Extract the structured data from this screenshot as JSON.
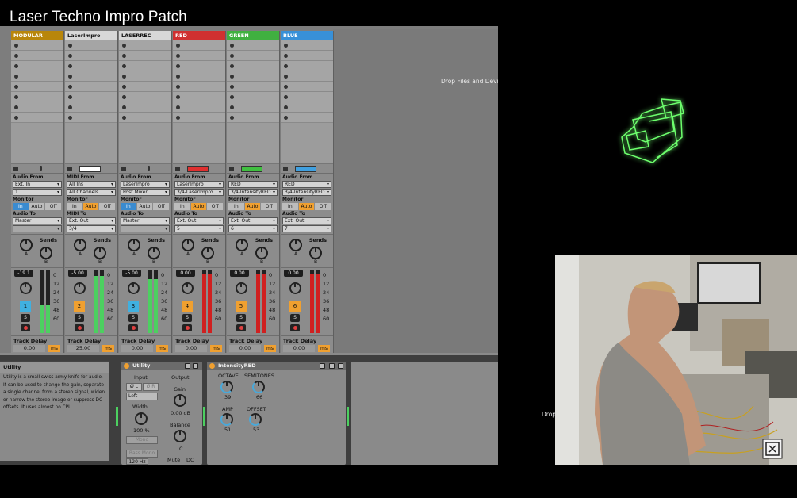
{
  "video_title": "Laser Techno Impro Patch",
  "drop_text": "Drop Files and Devices",
  "drop_text_bottom": "Drop",
  "tracks": [
    {
      "name": "MODULAR",
      "color": "#b8860b",
      "from_label": "Audio From",
      "from": "Ext. In",
      "chan": "1",
      "monitor": "In",
      "to_label": "Audio To",
      "to": "Master",
      "to2": "",
      "vol": "-19.1",
      "num": "1",
      "numcolor": "#40b0e0",
      "meterfill": "#4cd060",
      "meterlvl": 0.45,
      "delay": "0.00"
    },
    {
      "name": "LaserImpro",
      "color": "#d8d8d8",
      "from_label": "MIDI From",
      "from": "All Ins",
      "chan": "All Channels",
      "monitor": "Auto",
      "to_label": "MIDI To",
      "to": "Ext. Out",
      "to2": "3/4",
      "vol": "-5.00",
      "num": "2",
      "numcolor": "#f0a030",
      "meterfill": "#4cd060",
      "meterlvl": 0.9,
      "delay": "25.00"
    },
    {
      "name": "LASERREC",
      "color": "#d8d8d8",
      "from_label": "Audio From",
      "from": "LaserImpro",
      "chan": "Post Mixer",
      "monitor": "In",
      "to_label": "Audio To",
      "to": "Master",
      "to2": "",
      "vol": "-5.00",
      "num": "3",
      "numcolor": "#40b0e0",
      "meterfill": "#4cd060",
      "meterlvl": 0.85,
      "delay": "0.00"
    },
    {
      "name": "RED",
      "color": "#d03030",
      "from_label": "Audio From",
      "from": "LaserImpro",
      "chan": "3/4-LaserImpro",
      "monitor": "Auto",
      "to_label": "Audio To",
      "to": "Ext. Out",
      "to2": "5",
      "vol": "0.00",
      "num": "4",
      "numcolor": "#f0a030",
      "meterfill": "#d02020",
      "meterlvl": 0.92,
      "delay": "0.00"
    },
    {
      "name": "GREEN",
      "color": "#40b040",
      "from_label": "Audio From",
      "from": "RED",
      "chan": "3/4-IntensityRED",
      "monitor": "Auto",
      "to_label": "Audio To",
      "to": "Ext. Out",
      "to2": "6",
      "vol": "0.00",
      "num": "5",
      "numcolor": "#f0a030",
      "meterfill": "#d02020",
      "meterlvl": 0.92,
      "delay": "0.00"
    },
    {
      "name": "BLUE",
      "color": "#3890d8",
      "from_label": "Audio From",
      "from": "RED",
      "chan": "3/4-IntensityRED",
      "monitor": "Auto",
      "to_label": "Audio To",
      "to": "Ext. Out",
      "to2": "7",
      "vol": "0.00",
      "num": "6",
      "numcolor": "#f0a030",
      "meterfill": "#d02020",
      "meterlvl": 0.92,
      "delay": "0.00"
    }
  ],
  "indicator_colors": [
    "",
    "#ffffff",
    "",
    "#e03030",
    "#40c040",
    "#40a0e0"
  ],
  "labels": {
    "monitor": "Monitor",
    "in": "In",
    "auto": "Auto",
    "off": "Off",
    "sends": "Sends",
    "a": "A",
    "b": "B",
    "s": "S",
    "track_delay": "Track Delay",
    "ms": "ms"
  },
  "db_scale": [
    "0",
    "12",
    "24",
    "36",
    "48",
    "60"
  ],
  "info": {
    "title": "Utility",
    "body": "Utility is a small swiss army knife for audio. It can be used to change the gain, separate a single channel from a stereo signal, widen or narrow the stereo image or suppress DC offsets. It uses almost no CPU."
  },
  "utility": {
    "name": "Utility",
    "input": "Input",
    "output": "Output",
    "phase_l": "Ø L",
    "phase_r": "Ø R",
    "channel": "Left",
    "width_label": "Width",
    "width": "100 %",
    "mono": "Mono",
    "gain_label": "Gain",
    "gain": "0.00 dB",
    "balance_label": "Balance",
    "balance": "C",
    "bass_mono": "Bass Mono",
    "freq": "120 Hz",
    "mute": "Mute",
    "dc": "DC"
  },
  "intensity": {
    "name": "IntensityRED",
    "octave_label": "OCTAVE",
    "octave": "39",
    "semitones_label": "SEMITONES",
    "semitones": "66",
    "amp_label": "AMP",
    "amp": "51",
    "offset_label": "OFFSET",
    "offset": "53"
  }
}
